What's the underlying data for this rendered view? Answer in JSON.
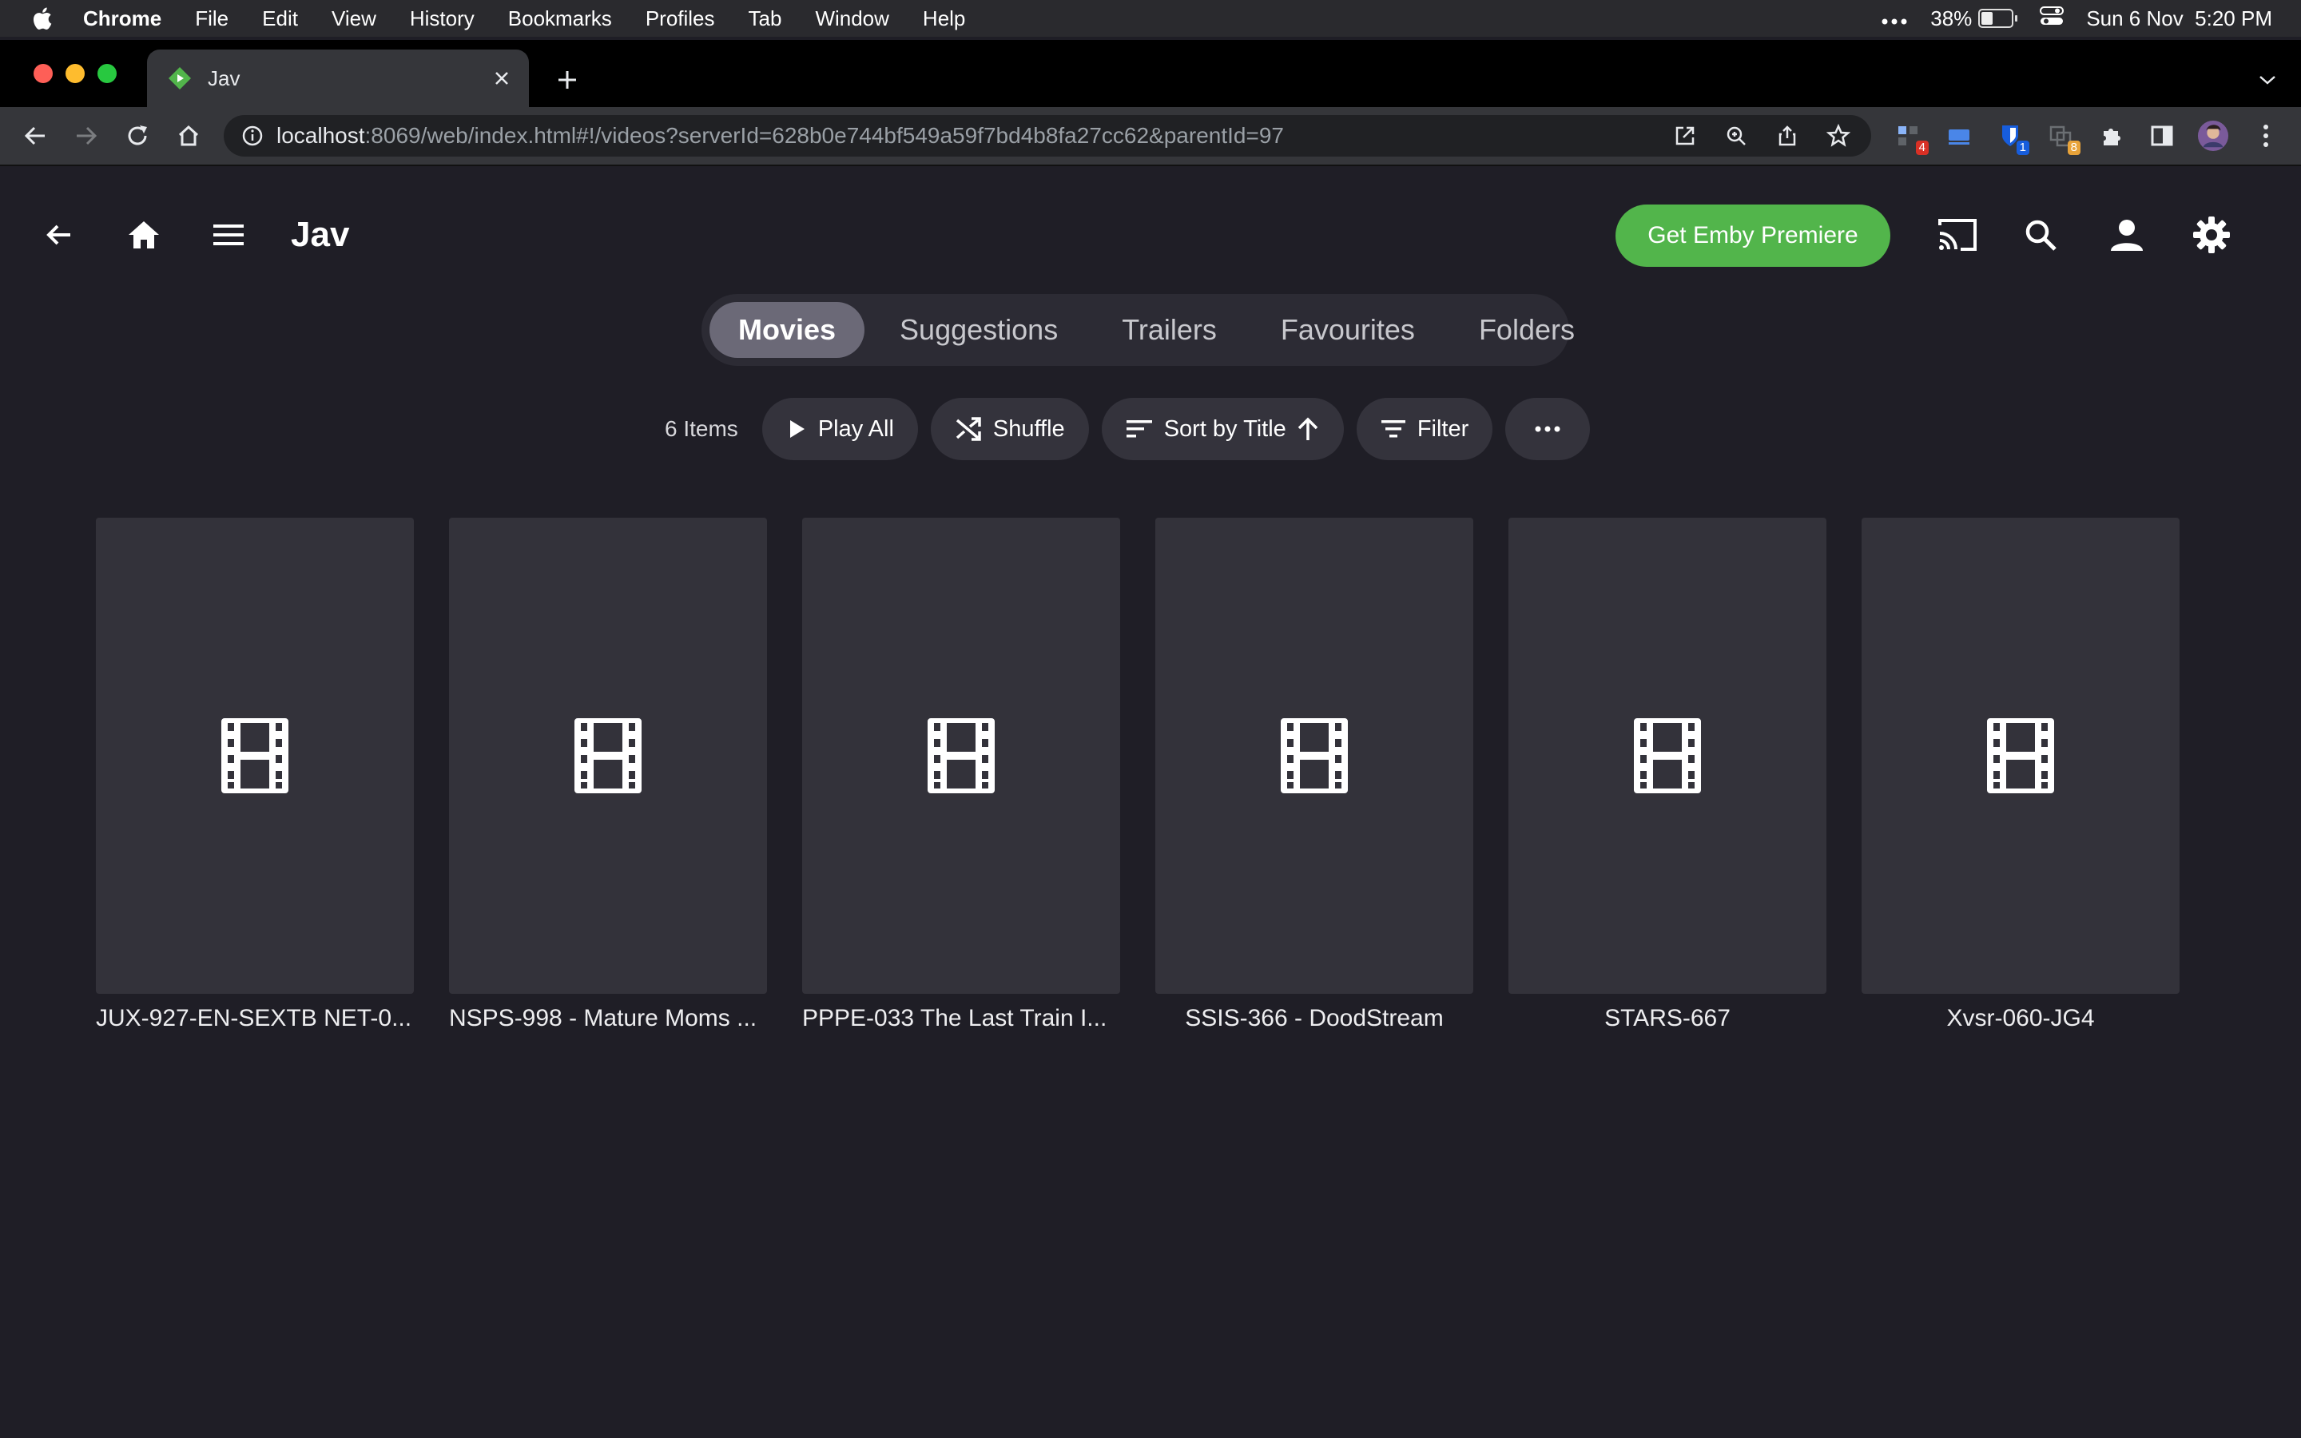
{
  "menubar": {
    "app_name": "Chrome",
    "items": [
      "File",
      "Edit",
      "View",
      "History",
      "Bookmarks",
      "Profiles",
      "Tab",
      "Window",
      "Help"
    ],
    "battery": "38%",
    "battery_level": 0.38,
    "datetime": "Sun 6 Nov  5:20 PM"
  },
  "browser": {
    "tab_title": "Jav",
    "url_host": "localhost",
    "url_rest": ":8069/web/index.html#!/videos?serverId=628b0e744bf549a59f7bd4b8fa27cc62&parentId=97",
    "extension_badges": [
      "4",
      "1",
      "8"
    ]
  },
  "app": {
    "page_title": "Jav",
    "premiere_label": "Get Emby Premiere",
    "tabs": [
      {
        "label": "Movies",
        "active": true
      },
      {
        "label": "Suggestions",
        "active": false
      },
      {
        "label": "Trailers",
        "active": false
      },
      {
        "label": "Favourites",
        "active": false
      },
      {
        "label": "Folders",
        "active": false
      }
    ],
    "item_count": "6 Items",
    "actions": {
      "play_all": "Play All",
      "shuffle": "Shuffle",
      "sort": "Sort by Title",
      "filter": "Filter"
    },
    "items": [
      {
        "title": "JUX-927-EN-SEXTB NET-0..."
      },
      {
        "title": "NSPS-998 - Mature Moms ..."
      },
      {
        "title": "PPPE-033 The Last Train I..."
      },
      {
        "title": "SSIS-366 - DoodStream"
      },
      {
        "title": "STARS-667"
      },
      {
        "title": "Xvsr-060-JG4"
      }
    ]
  },
  "colors": {
    "background": "#1f1e26",
    "premiere_green": "#52b54b",
    "active_tab": "#6b6977",
    "card": "#33323a"
  }
}
